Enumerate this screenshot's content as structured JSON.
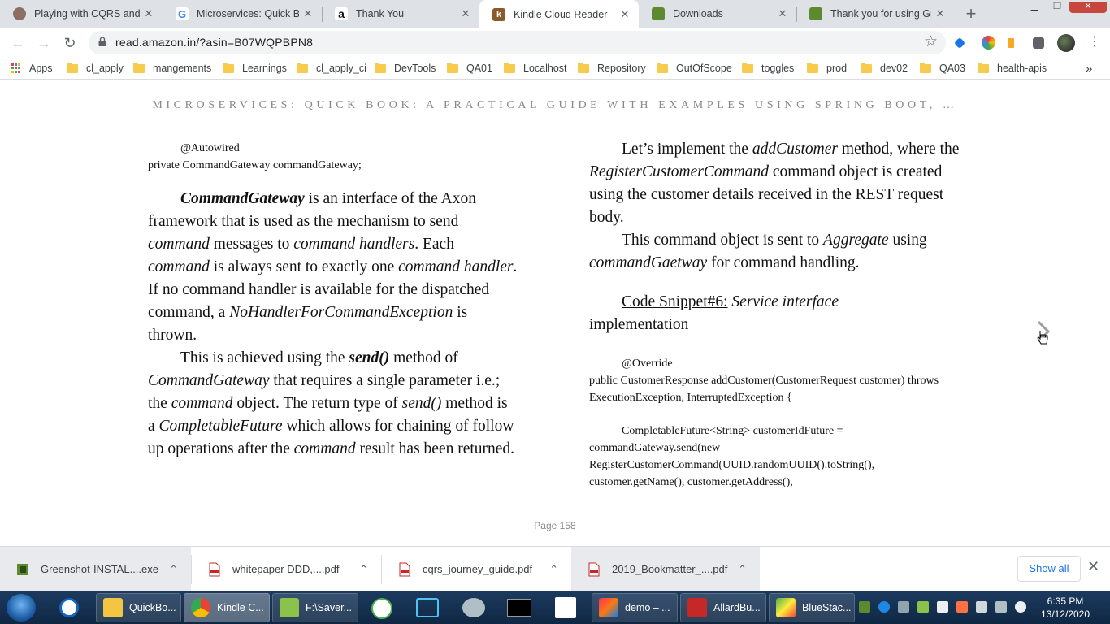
{
  "tabs": [
    {
      "title": "Playing with CQRS and E",
      "icon": "avatar-icon",
      "active": false
    },
    {
      "title": "Microservices: Quick Boo",
      "icon": "google-icon",
      "active": false
    },
    {
      "title": "Thank You",
      "icon": "amazon-icon",
      "active": false
    },
    {
      "title": "Kindle Cloud Reader",
      "icon": "kindle-icon",
      "active": true
    },
    {
      "title": "Downloads",
      "icon": "greenshot-icon",
      "active": false
    },
    {
      "title": "Thank you for using Gre",
      "icon": "greenshot-icon",
      "active": false
    }
  ],
  "toolbar": {
    "url": "read.amazon.in/?asin=B07WQPBPN8"
  },
  "bookmarks": {
    "apps_label": "Apps",
    "items": [
      "cl_apply",
      "mangements",
      "Learnings",
      "cl_apply_ci",
      "DevTools",
      "QA01",
      "Localhost",
      "Repository",
      "OutOfScope",
      "toggles",
      "prod",
      "dev02",
      "QA03",
      "health-apis"
    ],
    "overflow": "»"
  },
  "book": {
    "title": "MICROSERVICES: QUICK BOOK: A PRACTICAL GUIDE WITH EXAMPLES USING SPRING BOOT, …",
    "page_label": "Page 158",
    "left": {
      "code1": "@Autowired",
      "code2": "private CommandGateway commandGateway;",
      "p1": {
        "s1": "CommandGateway",
        "t1": " is an interface of the Axon framework that is used as the mechanism to send ",
        "s2": "command",
        "t2": " messages to ",
        "s3": "command handlers",
        "t3": ". Each ",
        "s4": "command",
        "t4": " is always sent to exactly one ",
        "s5": "command handler",
        "t5": ". If no command handler is available for the dispatched command, a ",
        "s6": "NoHandlerForCommandException",
        "t6": " is thrown."
      },
      "p2": {
        "t1": "This is achieved using the ",
        "s1": "send()",
        "t2": " method of ",
        "s2": "CommandGateway",
        "t3": " that requires a single parameter i.e.; the ",
        "s3": "command",
        "t4": " object. The return type of ",
        "s4": "send()",
        "t5": " method is a ",
        "s5": "CompletableFuture",
        "t6": " which allows for chaining of follow up operations after the ",
        "s6": "command",
        "t7": " result has been returned."
      }
    },
    "right": {
      "p1": {
        "t1": "Let’s implement the ",
        "s1": "addCustomer",
        "t2": " method, where  the ",
        "s2": "RegisterCustomerCommand",
        "t3": " command object is created using the customer details received in the REST request body."
      },
      "p2": {
        "t1": "This command object is sent to ",
        "s1": "Aggregate",
        "t2": " using ",
        "s2": "commandGaetway",
        "t3": " for command handling."
      },
      "snippet": {
        "label": "Code Snippet#6:",
        "title": "Service interface",
        "rest": "implementation"
      },
      "code1": "@Override",
      "code2": "public CustomerResponse addCustomer(CustomerRequest customer) throws ExecutionException, InterruptedException {",
      "code3": "CompletableFuture<String> customerIdFuture = commandGateway.send(new RegisterCustomerCommand(UUID.randomUUID().toString(), customer.getName(), customer.getAddress(),"
    }
  },
  "downloads": {
    "items": [
      "Greenshot-INSTAL....exe",
      "whitepaper DDD,....pdf",
      "cqrs_journey_guide.pdf",
      "2019_Bookmatter_....pdf"
    ],
    "show_all": "Show all"
  },
  "taskbar": {
    "items": [
      {
        "label": "QuickBo...",
        "icon": "folder-icon"
      },
      {
        "label": "Kindle C...",
        "icon": "chrome-icon"
      },
      {
        "label": "F:\\Saver...",
        "icon": "notepad-icon"
      },
      {
        "label": "demo – ...",
        "icon": "intellij-icon"
      },
      {
        "label": "AllardBu...",
        "icon": "pdf-icon"
      },
      {
        "label": "BlueStac...",
        "icon": "bluestacks-icon"
      }
    ],
    "time": "6:35 PM",
    "date": "13/12/2020"
  }
}
